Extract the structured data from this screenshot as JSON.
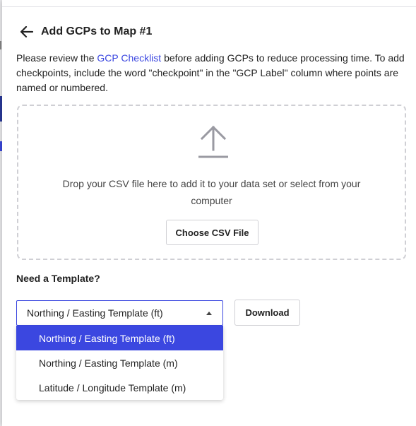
{
  "header": {
    "title": "Add GCPs to Map #1",
    "back_icon": "arrow-left-icon"
  },
  "intro": {
    "text_before": "Please review the ",
    "link_text": "GCP Checklist",
    "text_after": " before adding GCPs to reduce processing time. To add checkpoints, include the word \"checkpoint\" in the \"GCP Label\" column where points are named or numbered."
  },
  "dropzone": {
    "icon": "upload-icon",
    "instructions": "Drop your CSV file here to add it to your data set or select from your computer",
    "choose_label": "Choose CSV File"
  },
  "template": {
    "heading": "Need a Template?",
    "selected": "Northing / Easting Template (ft)",
    "download_label": "Download",
    "options": [
      "Northing / Easting Template (ft)",
      "Northing / Easting Template (m)",
      "Latitude / Longitude Template (m)"
    ],
    "selected_index": 0
  },
  "colors": {
    "accent": "#3b47e0",
    "border": "#cfcfd4",
    "text": "#222222"
  }
}
